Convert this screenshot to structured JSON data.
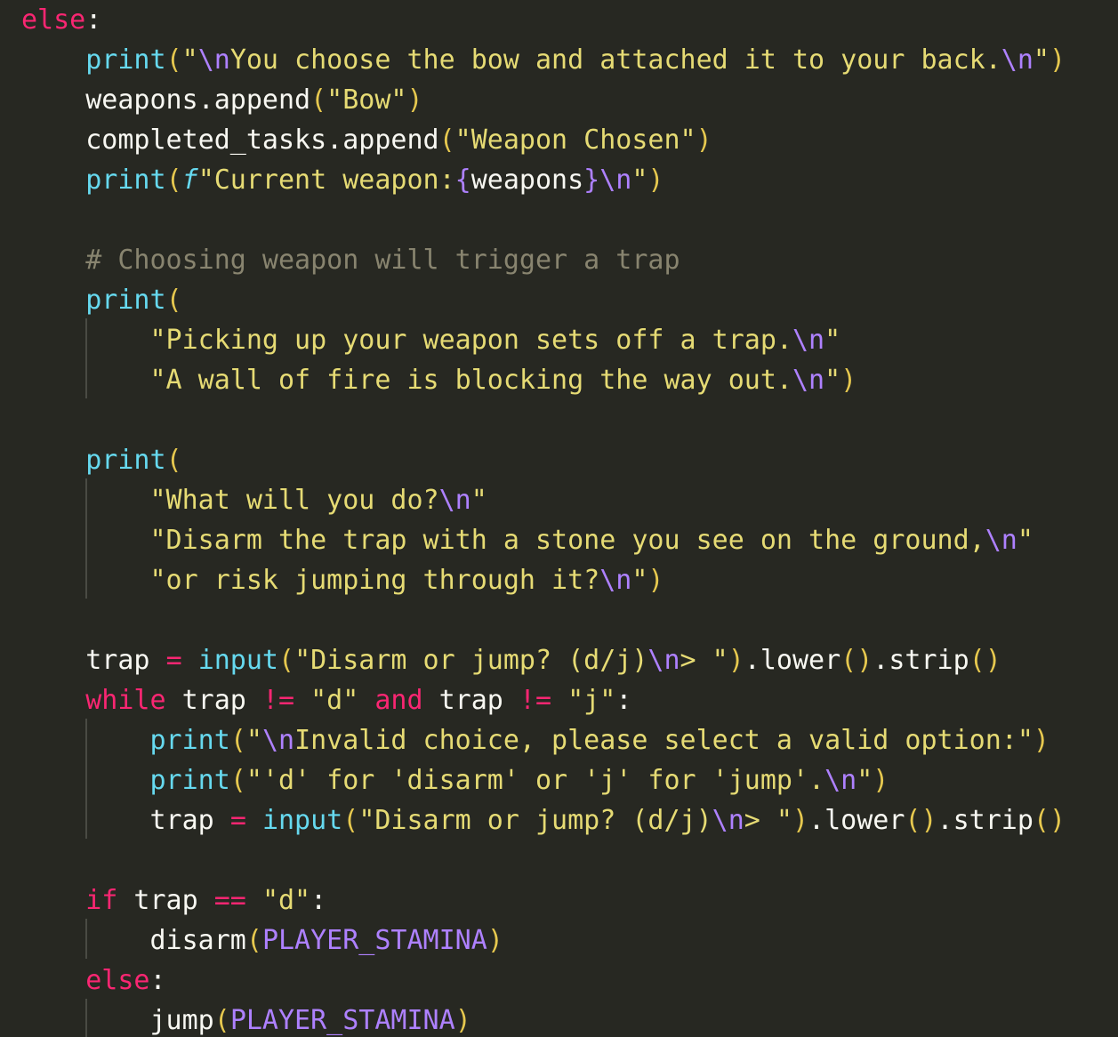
{
  "editor": {
    "language": "python",
    "theme": "monokai",
    "colors": {
      "background": "#272822",
      "keyword": "#f92672",
      "builtin": "#66d9ef",
      "string": "#e6db74",
      "escape": "#ae81ff",
      "constant": "#ae81ff",
      "comment": "#88846f",
      "bracket": "#e6c84f",
      "text": "#f8f8f2",
      "indent_guide": "#4a4b44"
    },
    "lines": [
      [
        {
          "t": "else",
          "c": "kw"
        },
        {
          "t": ":",
          "c": "id"
        }
      ],
      [
        {
          "t": "    ",
          "c": "id"
        },
        {
          "t": "print",
          "c": "fn"
        },
        {
          "t": "(",
          "c": "br"
        },
        {
          "t": "\"",
          "c": "str"
        },
        {
          "t": "\\n",
          "c": "esc"
        },
        {
          "t": "You choose the bow and attached it to your back.",
          "c": "str"
        },
        {
          "t": "\\n",
          "c": "esc"
        },
        {
          "t": "\"",
          "c": "str"
        },
        {
          "t": ")",
          "c": "br"
        }
      ],
      [
        {
          "t": "    weapons.append",
          "c": "id"
        },
        {
          "t": "(",
          "c": "br"
        },
        {
          "t": "\"Bow\"",
          "c": "str"
        },
        {
          "t": ")",
          "c": "br"
        }
      ],
      [
        {
          "t": "    completed_tasks.append",
          "c": "id"
        },
        {
          "t": "(",
          "c": "br"
        },
        {
          "t": "\"Weapon Chosen\"",
          "c": "str"
        },
        {
          "t": ")",
          "c": "br"
        }
      ],
      [
        {
          "t": "    ",
          "c": "id"
        },
        {
          "t": "print",
          "c": "fn"
        },
        {
          "t": "(",
          "c": "br"
        },
        {
          "t": "f",
          "c": "fi"
        },
        {
          "t": "\"Current weapon:",
          "c": "str"
        },
        {
          "t": "{",
          "c": "esc"
        },
        {
          "t": "weapons",
          "c": "id"
        },
        {
          "t": "}",
          "c": "esc"
        },
        {
          "t": "\\n",
          "c": "esc"
        },
        {
          "t": "\"",
          "c": "str"
        },
        {
          "t": ")",
          "c": "br"
        }
      ],
      [],
      [
        {
          "t": "    ",
          "c": "id"
        },
        {
          "t": "# Choosing weapon will trigger a trap",
          "c": "cm"
        }
      ],
      [
        {
          "t": "    ",
          "c": "id"
        },
        {
          "t": "print",
          "c": "fn"
        },
        {
          "t": "(",
          "c": "br"
        }
      ],
      [
        {
          "t": "        ",
          "c": "id"
        },
        {
          "t": "\"Picking up your weapon sets off a trap.",
          "c": "str"
        },
        {
          "t": "\\n",
          "c": "esc"
        },
        {
          "t": "\"",
          "c": "str"
        }
      ],
      [
        {
          "t": "        ",
          "c": "id"
        },
        {
          "t": "\"A wall of fire is blocking the way out.",
          "c": "str"
        },
        {
          "t": "\\n",
          "c": "esc"
        },
        {
          "t": "\"",
          "c": "str"
        },
        {
          "t": ")",
          "c": "br"
        }
      ],
      [],
      [
        {
          "t": "    ",
          "c": "id"
        },
        {
          "t": "print",
          "c": "fn"
        },
        {
          "t": "(",
          "c": "br"
        }
      ],
      [
        {
          "t": "        ",
          "c": "id"
        },
        {
          "t": "\"What will you do?",
          "c": "str"
        },
        {
          "t": "\\n",
          "c": "esc"
        },
        {
          "t": "\"",
          "c": "str"
        }
      ],
      [
        {
          "t": "        ",
          "c": "id"
        },
        {
          "t": "\"Disarm the trap with a stone you see on the ground,",
          "c": "str"
        },
        {
          "t": "\\n",
          "c": "esc"
        },
        {
          "t": "\"",
          "c": "str"
        }
      ],
      [
        {
          "t": "        ",
          "c": "id"
        },
        {
          "t": "\"or risk jumping through it?",
          "c": "str"
        },
        {
          "t": "\\n",
          "c": "esc"
        },
        {
          "t": "\"",
          "c": "str"
        },
        {
          "t": ")",
          "c": "br"
        }
      ],
      [],
      [
        {
          "t": "    trap ",
          "c": "id"
        },
        {
          "t": "=",
          "c": "op"
        },
        {
          "t": " ",
          "c": "id"
        },
        {
          "t": "input",
          "c": "fn"
        },
        {
          "t": "(",
          "c": "br"
        },
        {
          "t": "\"Disarm or jump? (d/j)",
          "c": "str"
        },
        {
          "t": "\\n",
          "c": "esc"
        },
        {
          "t": "> \"",
          "c": "str"
        },
        {
          "t": ")",
          "c": "br"
        },
        {
          "t": ".lower",
          "c": "id"
        },
        {
          "t": "()",
          "c": "br"
        },
        {
          "t": ".strip",
          "c": "id"
        },
        {
          "t": "()",
          "c": "br"
        }
      ],
      [
        {
          "t": "    ",
          "c": "id"
        },
        {
          "t": "while",
          "c": "kw"
        },
        {
          "t": " trap ",
          "c": "id"
        },
        {
          "t": "!=",
          "c": "op"
        },
        {
          "t": " ",
          "c": "id"
        },
        {
          "t": "\"d\"",
          "c": "str"
        },
        {
          "t": " ",
          "c": "id"
        },
        {
          "t": "and",
          "c": "kw"
        },
        {
          "t": " trap ",
          "c": "id"
        },
        {
          "t": "!=",
          "c": "op"
        },
        {
          "t": " ",
          "c": "id"
        },
        {
          "t": "\"j\"",
          "c": "str"
        },
        {
          "t": ":",
          "c": "id"
        }
      ],
      [
        {
          "t": "        ",
          "c": "id"
        },
        {
          "t": "print",
          "c": "fn"
        },
        {
          "t": "(",
          "c": "br"
        },
        {
          "t": "\"",
          "c": "str"
        },
        {
          "t": "\\n",
          "c": "esc"
        },
        {
          "t": "Invalid choice, please select a valid option:\"",
          "c": "str"
        },
        {
          "t": ")",
          "c": "br"
        }
      ],
      [
        {
          "t": "        ",
          "c": "id"
        },
        {
          "t": "print",
          "c": "fn"
        },
        {
          "t": "(",
          "c": "br"
        },
        {
          "t": "\"'d' for 'disarm' or 'j' for 'jump'.",
          "c": "str"
        },
        {
          "t": "\\n",
          "c": "esc"
        },
        {
          "t": "\"",
          "c": "str"
        },
        {
          "t": ")",
          "c": "br"
        }
      ],
      [
        {
          "t": "        trap ",
          "c": "id"
        },
        {
          "t": "=",
          "c": "op"
        },
        {
          "t": " ",
          "c": "id"
        },
        {
          "t": "input",
          "c": "fn"
        },
        {
          "t": "(",
          "c": "br"
        },
        {
          "t": "\"Disarm or jump? (d/j)",
          "c": "str"
        },
        {
          "t": "\\n",
          "c": "esc"
        },
        {
          "t": "> \"",
          "c": "str"
        },
        {
          "t": ")",
          "c": "br"
        },
        {
          "t": ".lower",
          "c": "id"
        },
        {
          "t": "()",
          "c": "br"
        },
        {
          "t": ".strip",
          "c": "id"
        },
        {
          "t": "()",
          "c": "br"
        }
      ],
      [],
      [
        {
          "t": "    ",
          "c": "id"
        },
        {
          "t": "if",
          "c": "kw"
        },
        {
          "t": " trap ",
          "c": "id"
        },
        {
          "t": "==",
          "c": "op"
        },
        {
          "t": " ",
          "c": "id"
        },
        {
          "t": "\"d\"",
          "c": "str"
        },
        {
          "t": ":",
          "c": "id"
        }
      ],
      [
        {
          "t": "        disarm",
          "c": "id"
        },
        {
          "t": "(",
          "c": "br"
        },
        {
          "t": "PLAYER_STAMINA",
          "c": "cst"
        },
        {
          "t": ")",
          "c": "br"
        }
      ],
      [
        {
          "t": "    ",
          "c": "id"
        },
        {
          "t": "else",
          "c": "kw"
        },
        {
          "t": ":",
          "c": "id"
        }
      ],
      [
        {
          "t": "        jump",
          "c": "id"
        },
        {
          "t": "(",
          "c": "br"
        },
        {
          "t": "PLAYER_STAMINA",
          "c": "cst"
        },
        {
          "t": ")",
          "c": "br"
        }
      ]
    ]
  }
}
